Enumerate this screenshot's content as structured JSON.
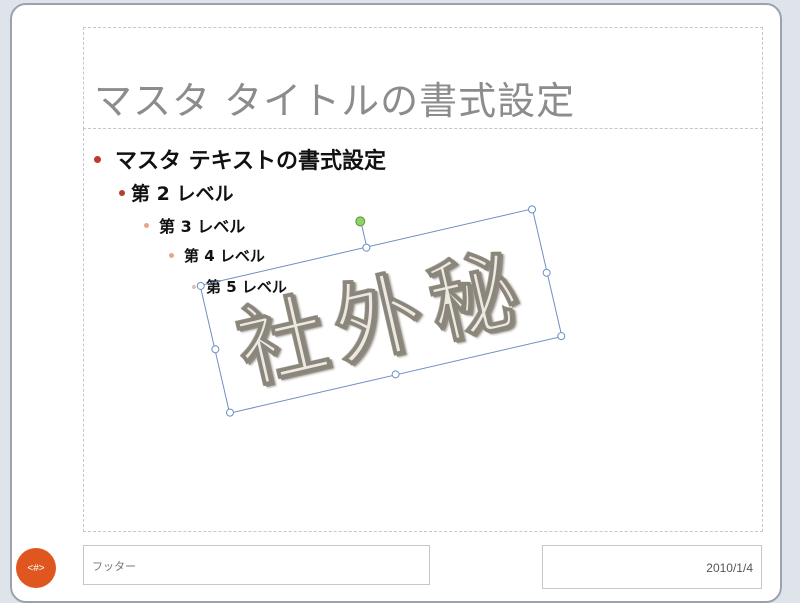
{
  "slide_master": {
    "title_placeholder": "マスタ タイトルの書式設定",
    "body_levels": [
      "マスタ テキストの書式設定",
      "第 2 レベル",
      "第 3 レベル",
      "第 4 レベル",
      "第 5 レベル"
    ],
    "footer_placeholder": "フッター",
    "date_placeholder": "2010/1/4",
    "page_number_placeholder": "<#>"
  },
  "wordart": {
    "text": "社外秘",
    "selected": true
  },
  "colors": {
    "bullet_level1": "#c0392b",
    "page_number_badge": "#e0561f",
    "selection_outline": "#6e8fc3",
    "rotate_handle": "#8fd16a"
  }
}
